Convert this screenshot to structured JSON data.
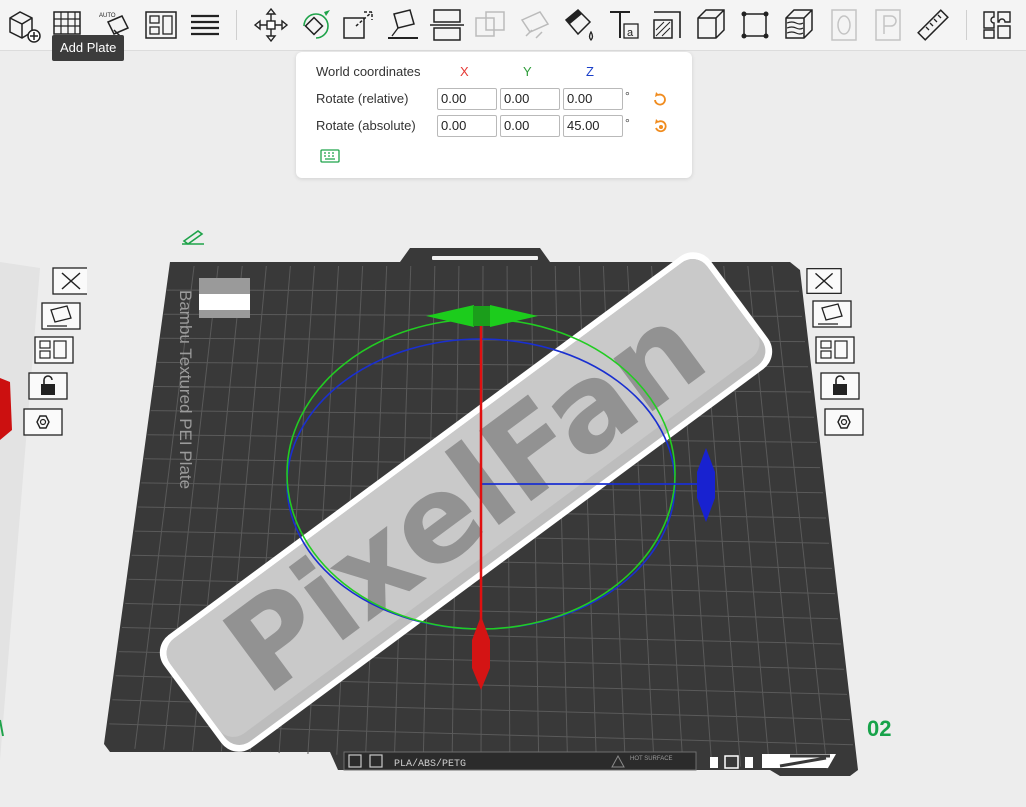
{
  "toolbar": {
    "tooltip": "Add Plate",
    "auto_label": "AUTO",
    "tools": [
      {
        "name": "add-object-icon"
      },
      {
        "name": "add-plate-icon"
      },
      {
        "name": "auto-orient-icon"
      },
      {
        "name": "arrange-icon"
      },
      {
        "name": "split-icon"
      },
      {
        "name": "move-icon"
      },
      {
        "name": "rotate-icon"
      },
      {
        "name": "scale-icon"
      },
      {
        "name": "lay-on-face-icon"
      },
      {
        "name": "cut-icon"
      },
      {
        "name": "mesh-boolean-icon"
      },
      {
        "name": "support-paint-icon"
      },
      {
        "name": "color-paint-icon"
      },
      {
        "name": "text-icon"
      },
      {
        "name": "seam-paint-icon"
      },
      {
        "name": "measure-box-icon"
      },
      {
        "name": "fit-view-icon"
      },
      {
        "name": "variable-layer-height-icon"
      },
      {
        "name": "zero-icon"
      },
      {
        "name": "p-icon"
      },
      {
        "name": "ruler-icon"
      },
      {
        "name": "assembly-icon"
      }
    ]
  },
  "rotate_panel": {
    "header_label": "World coordinates",
    "axes": [
      "X",
      "Y",
      "Z"
    ],
    "axis_colors": {
      "X": "#e53935",
      "Y": "#2e9d3a",
      "Z": "#1a3fc9"
    },
    "rows": [
      {
        "label": "Rotate (relative)",
        "values": [
          "0.00",
          "0.00",
          "0.00"
        ],
        "unit": "°"
      },
      {
        "label": "Rotate (absolute)",
        "values": [
          "0.00",
          "0.00",
          "45.00"
        ],
        "unit": "°"
      }
    ]
  },
  "plate": {
    "model_text": "PixelFan",
    "plate_type_text": "Bambu Textured PEI Plate",
    "filament_text": "PLA/ABS/PETG",
    "hot_surface_text": "HOT\nSURFACE",
    "plate_number": "02"
  },
  "colors": {
    "accent": "#f08c1f",
    "plate_number": "#17a34a",
    "bed": "#3a3a3a",
    "bed_grid": "#5c5c5c"
  }
}
